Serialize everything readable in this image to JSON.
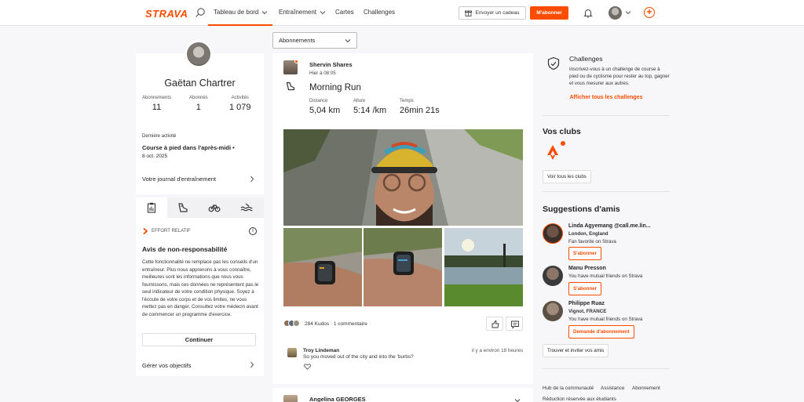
{
  "nav": {
    "logo": "STRAVA",
    "items": [
      {
        "label": "Tableau de bord"
      },
      {
        "label": "Entraînement"
      },
      {
        "label": "Cartes"
      },
      {
        "label": "Challenges"
      }
    ],
    "gift_label": "Envoyer un cadeau",
    "subscribe_label": "M'abonner"
  },
  "colors": {
    "accent": "#fc4c02",
    "page_bg": "#f7f7fa"
  },
  "profile": {
    "name": "Gaëtan Chartrer",
    "stats": [
      {
        "label": "Abonnements",
        "value": "11"
      },
      {
        "label": "Abonnés",
        "value": "1"
      },
      {
        "label": "Activités",
        "value": "1 079"
      }
    ],
    "last_activity_label": "Dernière activité",
    "last_activity_title": "Course à pied dans l'après-midi •",
    "last_activity_date": "8 oct. 2025",
    "journal_label": "Votre journal d'entraînement"
  },
  "effort": {
    "tabs": [
      "clipboard-icon",
      "shoe-icon",
      "bike-icon",
      "swim-icon"
    ],
    "section_label": "EFFORT RELATIF",
    "title": "Avis de non-responsabilité",
    "text": "Cette fonctionnalité ne remplace pas les conseils d'un entraîneur. Plus nous apprenons à vous connaître, meilleures sont les informations que nous vous fournissons, mais ces données ne représentent pas le seul indicateur de votre condition physique. Soyez à l'écoute de votre corps et de vos limites, ne vous mettez pas en danger. Consultez votre médecin avant de commencer un programme d'exercice.",
    "continue_label": "Continuer",
    "goals_label": "Gérer vos objectifs"
  },
  "feed": {
    "filter_label": "Abonnements",
    "activity": {
      "athlete": "Shervin Shares",
      "time": "Hier à 08:05",
      "title": "Morning Run",
      "metrics": [
        {
          "label": "Distance",
          "value": "5,04 km"
        },
        {
          "label": "Allure",
          "value": "5:14 /km"
        },
        {
          "label": "Temps",
          "value": "26min 21s"
        }
      ],
      "kudos_text": "284 Kudos · 1 commentaire",
      "comment": {
        "author": "Troy Lindeman",
        "text": "So you moved out of the city and into the 'burbs?",
        "time": "il y a environ 18 heures"
      }
    },
    "next_athlete": "Angelina GEORGES"
  },
  "sidebar": {
    "challenges_title": "Challenges",
    "challenges_text": "Inscrivez-vous à un challenge de course à pied ou de cyclisme pour rester au top, gagner et vous mesurer aux autres.",
    "challenges_link": "Afficher tous les challenges",
    "clubs_title": "Vos clubs",
    "clubs_button": "Voir tous les clubs",
    "suggestions_title": "Suggestions d'amis",
    "friends": [
      {
        "name": "Linda Agyemang @call.me.lin...",
        "line1": "London, England",
        "line2": "Fan favorite on Strava",
        "button": "S'abonner"
      },
      {
        "name": "Manu Presson",
        "line1": "You have mutual friends on Strava",
        "line2": "",
        "button": "S'abonner"
      },
      {
        "name": "Philippe Ruaz",
        "line1": "Vignot, FRANCE",
        "line2": "You have mutual friends on Strava",
        "button": "Demande d'abonnement"
      }
    ],
    "invite_label": "Trouver et inviter vos amis",
    "footer_links": [
      "Hub de la communauté",
      "Assistance",
      "Abonnement",
      "Réduction réservée aux étudiants"
    ]
  }
}
